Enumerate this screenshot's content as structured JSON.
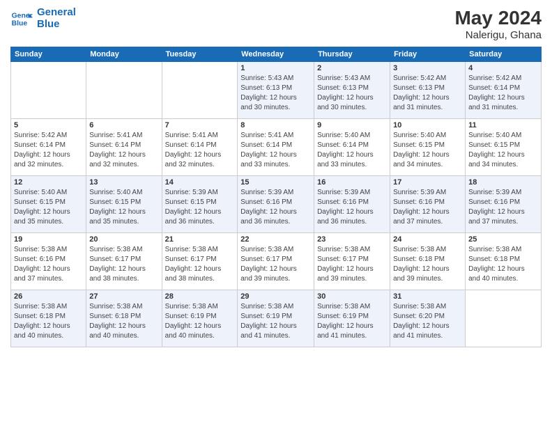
{
  "header": {
    "logo_line1": "General",
    "logo_line2": "Blue",
    "month_year": "May 2024",
    "location": "Nalerigu, Ghana"
  },
  "weekdays": [
    "Sunday",
    "Monday",
    "Tuesday",
    "Wednesday",
    "Thursday",
    "Friday",
    "Saturday"
  ],
  "weeks": [
    [
      {
        "day": "",
        "info": ""
      },
      {
        "day": "",
        "info": ""
      },
      {
        "day": "",
        "info": ""
      },
      {
        "day": "1",
        "info": "Sunrise: 5:43 AM\nSunset: 6:13 PM\nDaylight: 12 hours\nand 30 minutes."
      },
      {
        "day": "2",
        "info": "Sunrise: 5:43 AM\nSunset: 6:13 PM\nDaylight: 12 hours\nand 30 minutes."
      },
      {
        "day": "3",
        "info": "Sunrise: 5:42 AM\nSunset: 6:13 PM\nDaylight: 12 hours\nand 31 minutes."
      },
      {
        "day": "4",
        "info": "Sunrise: 5:42 AM\nSunset: 6:14 PM\nDaylight: 12 hours\nand 31 minutes."
      }
    ],
    [
      {
        "day": "5",
        "info": "Sunrise: 5:42 AM\nSunset: 6:14 PM\nDaylight: 12 hours\nand 32 minutes."
      },
      {
        "day": "6",
        "info": "Sunrise: 5:41 AM\nSunset: 6:14 PM\nDaylight: 12 hours\nand 32 minutes."
      },
      {
        "day": "7",
        "info": "Sunrise: 5:41 AM\nSunset: 6:14 PM\nDaylight: 12 hours\nand 32 minutes."
      },
      {
        "day": "8",
        "info": "Sunrise: 5:41 AM\nSunset: 6:14 PM\nDaylight: 12 hours\nand 33 minutes."
      },
      {
        "day": "9",
        "info": "Sunrise: 5:40 AM\nSunset: 6:14 PM\nDaylight: 12 hours\nand 33 minutes."
      },
      {
        "day": "10",
        "info": "Sunrise: 5:40 AM\nSunset: 6:15 PM\nDaylight: 12 hours\nand 34 minutes."
      },
      {
        "day": "11",
        "info": "Sunrise: 5:40 AM\nSunset: 6:15 PM\nDaylight: 12 hours\nand 34 minutes."
      }
    ],
    [
      {
        "day": "12",
        "info": "Sunrise: 5:40 AM\nSunset: 6:15 PM\nDaylight: 12 hours\nand 35 minutes."
      },
      {
        "day": "13",
        "info": "Sunrise: 5:40 AM\nSunset: 6:15 PM\nDaylight: 12 hours\nand 35 minutes."
      },
      {
        "day": "14",
        "info": "Sunrise: 5:39 AM\nSunset: 6:15 PM\nDaylight: 12 hours\nand 36 minutes."
      },
      {
        "day": "15",
        "info": "Sunrise: 5:39 AM\nSunset: 6:16 PM\nDaylight: 12 hours\nand 36 minutes."
      },
      {
        "day": "16",
        "info": "Sunrise: 5:39 AM\nSunset: 6:16 PM\nDaylight: 12 hours\nand 36 minutes."
      },
      {
        "day": "17",
        "info": "Sunrise: 5:39 AM\nSunset: 6:16 PM\nDaylight: 12 hours\nand 37 minutes."
      },
      {
        "day": "18",
        "info": "Sunrise: 5:39 AM\nSunset: 6:16 PM\nDaylight: 12 hours\nand 37 minutes."
      }
    ],
    [
      {
        "day": "19",
        "info": "Sunrise: 5:38 AM\nSunset: 6:16 PM\nDaylight: 12 hours\nand 37 minutes."
      },
      {
        "day": "20",
        "info": "Sunrise: 5:38 AM\nSunset: 6:17 PM\nDaylight: 12 hours\nand 38 minutes."
      },
      {
        "day": "21",
        "info": "Sunrise: 5:38 AM\nSunset: 6:17 PM\nDaylight: 12 hours\nand 38 minutes."
      },
      {
        "day": "22",
        "info": "Sunrise: 5:38 AM\nSunset: 6:17 PM\nDaylight: 12 hours\nand 39 minutes."
      },
      {
        "day": "23",
        "info": "Sunrise: 5:38 AM\nSunset: 6:17 PM\nDaylight: 12 hours\nand 39 minutes."
      },
      {
        "day": "24",
        "info": "Sunrise: 5:38 AM\nSunset: 6:18 PM\nDaylight: 12 hours\nand 39 minutes."
      },
      {
        "day": "25",
        "info": "Sunrise: 5:38 AM\nSunset: 6:18 PM\nDaylight: 12 hours\nand 40 minutes."
      }
    ],
    [
      {
        "day": "26",
        "info": "Sunrise: 5:38 AM\nSunset: 6:18 PM\nDaylight: 12 hours\nand 40 minutes."
      },
      {
        "day": "27",
        "info": "Sunrise: 5:38 AM\nSunset: 6:18 PM\nDaylight: 12 hours\nand 40 minutes."
      },
      {
        "day": "28",
        "info": "Sunrise: 5:38 AM\nSunset: 6:19 PM\nDaylight: 12 hours\nand 40 minutes."
      },
      {
        "day": "29",
        "info": "Sunrise: 5:38 AM\nSunset: 6:19 PM\nDaylight: 12 hours\nand 41 minutes."
      },
      {
        "day": "30",
        "info": "Sunrise: 5:38 AM\nSunset: 6:19 PM\nDaylight: 12 hours\nand 41 minutes."
      },
      {
        "day": "31",
        "info": "Sunrise: 5:38 AM\nSunset: 6:20 PM\nDaylight: 12 hours\nand 41 minutes."
      },
      {
        "day": "",
        "info": ""
      }
    ]
  ]
}
